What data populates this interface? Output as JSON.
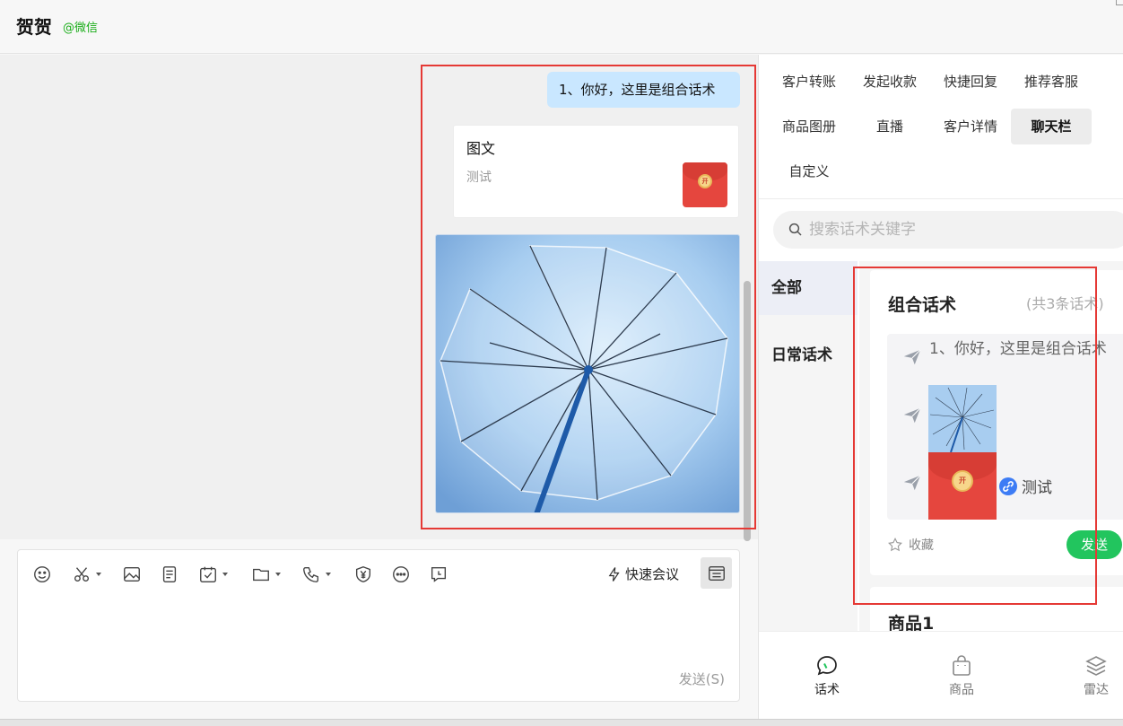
{
  "header": {
    "contact_name": "贺贺",
    "contact_tag": "@微信"
  },
  "chat": {
    "message_text": "1、你好，这里是组合话术",
    "article_card": {
      "title": "图文",
      "desc": "测试",
      "envelope_label": "开"
    }
  },
  "input": {
    "quick_meeting": "快速会议",
    "send_hint": "发送(S)"
  },
  "right_panel": {
    "tabs": [
      "客户转账",
      "发起收款",
      "快捷回复",
      "推荐客服",
      "商品图册",
      "直播",
      "客户详情",
      "聊天栏",
      "自定义"
    ],
    "active_tab": "聊天栏",
    "search_placeholder": "搜索话术关键字",
    "categories": [
      "全部",
      "日常话术"
    ],
    "active_category": "全部",
    "script_card": {
      "title": "组合话术",
      "count": "(共3条话术)",
      "line1": "1、你好，这里是组合话术",
      "envelope_label": "开",
      "link_text": "测试",
      "favorite": "收藏",
      "send": "发送"
    },
    "next_card_title": "商品1",
    "bottom_nav": [
      "话术",
      "商品",
      "雷达"
    ],
    "active_nav": "话术"
  },
  "colors": {
    "accent_green": "#22c55e",
    "bubble_blue": "#c9e7ff",
    "highlight_red": "#e53935",
    "contact_tag": "#1aad19"
  },
  "icons": [
    "smile-icon",
    "scissors-icon",
    "image-icon",
    "document-icon",
    "calendar-check-icon",
    "folder-icon",
    "phone-icon",
    "yuan-shield-icon",
    "more-icon",
    "chat-bubble-icon",
    "lightning-icon",
    "panel-toggle-icon",
    "search-icon",
    "send-plane-icon",
    "link-icon",
    "star-icon",
    "speech-icon",
    "bag-icon",
    "layers-icon"
  ]
}
